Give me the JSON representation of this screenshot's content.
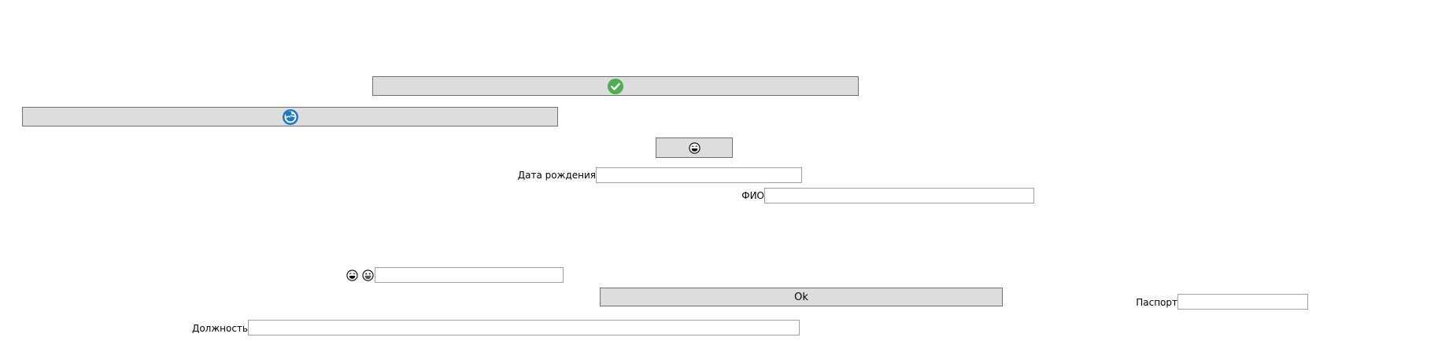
{
  "buttons": {
    "confirm_icon": "check-circle-icon",
    "refresh_icon": "refresh-cloud-icon",
    "emoji_icon": "laughing-face-icon",
    "ok_label": "Ok"
  },
  "fields": {
    "birth_date": {
      "label": "Дата рождения",
      "value": ""
    },
    "full_name": {
      "label": "ФИО",
      "value": ""
    },
    "emoji_field": {
      "value": ""
    },
    "passport": {
      "label": "Паспорт",
      "value": ""
    },
    "position": {
      "label": "Должность",
      "value": ""
    }
  },
  "colors": {
    "check_green": "#4caf50",
    "refresh_blue": "#1976d2",
    "button_face": "#dddddd"
  }
}
